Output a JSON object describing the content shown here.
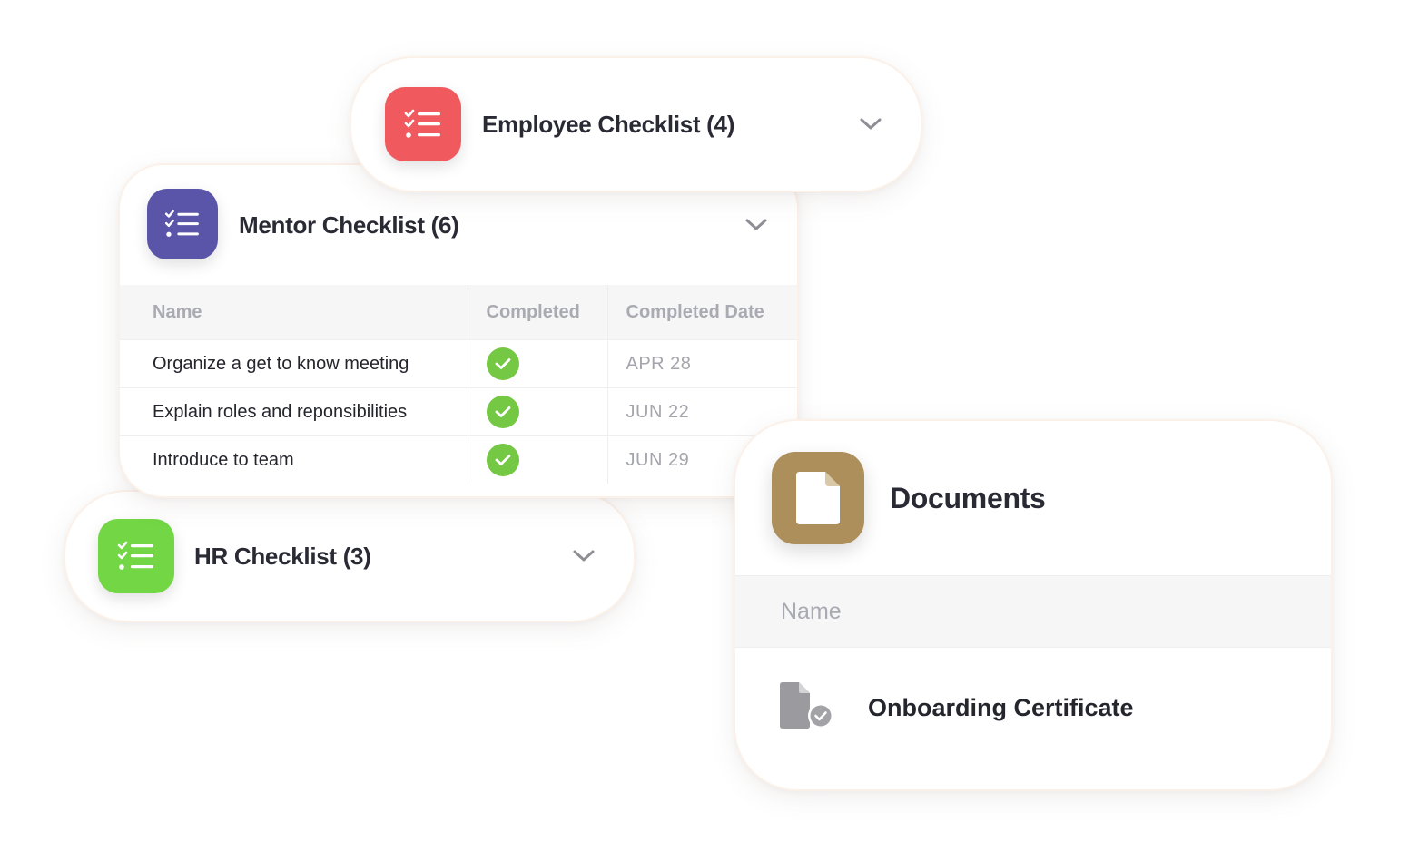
{
  "employee_checklist": {
    "title": "Employee Checklist (4)",
    "icon": "checklist-icon",
    "accent": "#f05a5e"
  },
  "mentor_checklist": {
    "title": "Mentor Checklist (6)",
    "icon": "checklist-icon",
    "accent": "#5a55a8",
    "columns": [
      "Name",
      "Completed",
      "Completed Date"
    ],
    "rows": [
      {
        "name": "Organize a get to know meeting",
        "completed": true,
        "date": "APR 28"
      },
      {
        "name": "Explain roles and reponsibilities",
        "completed": true,
        "date": "JUN 22"
      },
      {
        "name": "Introduce to team",
        "completed": true,
        "date": "JUN 29"
      }
    ]
  },
  "hr_checklist": {
    "title": "HR Checklist (3)",
    "icon": "checklist-icon",
    "accent": "#72d645"
  },
  "documents": {
    "title": "Documents",
    "icon": "document-icon",
    "accent": "#ad8f5c",
    "column": "Name",
    "items": [
      {
        "name": "Onboarding Certificate",
        "icon": "certificate-file-icon"
      }
    ]
  },
  "colors": {
    "check_green": "#75c843",
    "muted_text": "#a9aab2",
    "dark_text": "#25252e"
  }
}
